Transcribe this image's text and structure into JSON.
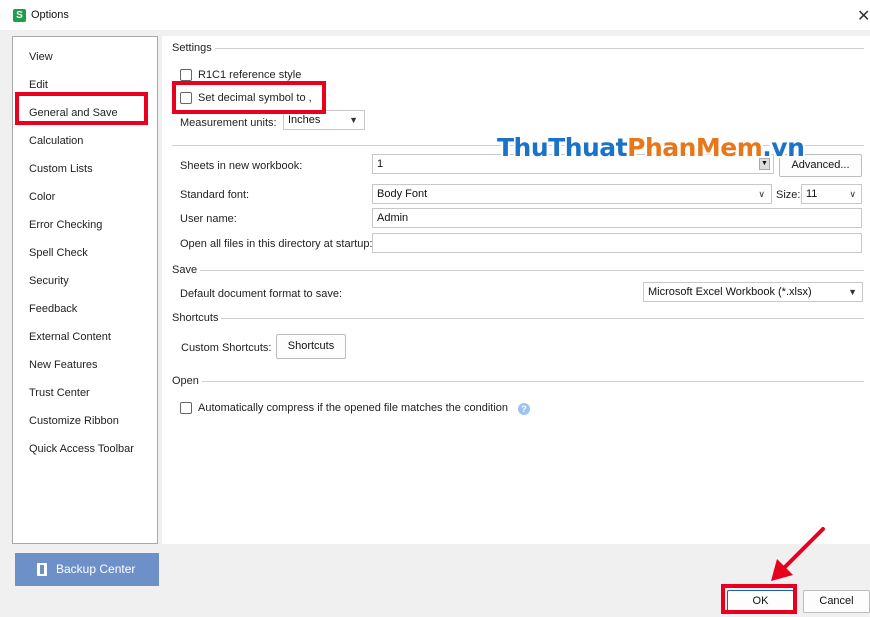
{
  "window": {
    "app_icon_letter": "S",
    "title": "Options",
    "close_glyph": "✕"
  },
  "sidebar": {
    "items": [
      {
        "label": "View"
      },
      {
        "label": "Edit"
      },
      {
        "label": "General and Save"
      },
      {
        "label": "Calculation"
      },
      {
        "label": "Custom Lists"
      },
      {
        "label": "Color"
      },
      {
        "label": "Error Checking"
      },
      {
        "label": "Spell Check"
      },
      {
        "label": "Security"
      },
      {
        "label": "Feedback"
      },
      {
        "label": "External Content"
      },
      {
        "label": "New Features"
      },
      {
        "label": "Trust Center"
      },
      {
        "label": "Customize Ribbon"
      },
      {
        "label": "Quick Access Toolbar"
      }
    ],
    "selected": "General and Save",
    "backup_label": "Backup Center"
  },
  "settings": {
    "section_title": "Settings",
    "r1c1_label": "R1C1 reference style",
    "r1c1_checked": false,
    "decimal_label": "Set decimal symbol to ,",
    "decimal_checked": false,
    "measurement_label": "Measurement units:",
    "measurement_value": "Inches",
    "sheets_label": "Sheets in new workbook:",
    "sheets_value": "1",
    "advanced_label": "Advanced...",
    "font_label": "Standard font:",
    "font_value": "Body Font",
    "size_label": "Size:",
    "size_value": "11",
    "username_label": "User name:",
    "username_value": "Admin",
    "open_dir_label": "Open all files in this directory at startup:",
    "open_dir_value": ""
  },
  "save": {
    "section_title": "Save",
    "format_label": "Default document format to save:",
    "format_value": "Microsoft Excel Workbook (*.xlsx)"
  },
  "shortcuts": {
    "section_title": "Shortcuts",
    "custom_label": "Custom Shortcuts:",
    "button_label": "Shortcuts"
  },
  "open": {
    "section_title": "Open",
    "compress_label": "Automatically compress if the opened file matches the condition",
    "compress_checked": false,
    "help_glyph": "?"
  },
  "footer": {
    "ok_label": "OK",
    "cancel_label": "Cancel"
  },
  "watermark": {
    "part1": "ThuThuat",
    "part2": "PhanMem",
    "part3": ".vn"
  },
  "colors": {
    "highlight_red": "#e8001c",
    "backup_blue": "#6e90c9",
    "watermark_blue": "#1a73c9",
    "watermark_orange": "#e8771b"
  }
}
